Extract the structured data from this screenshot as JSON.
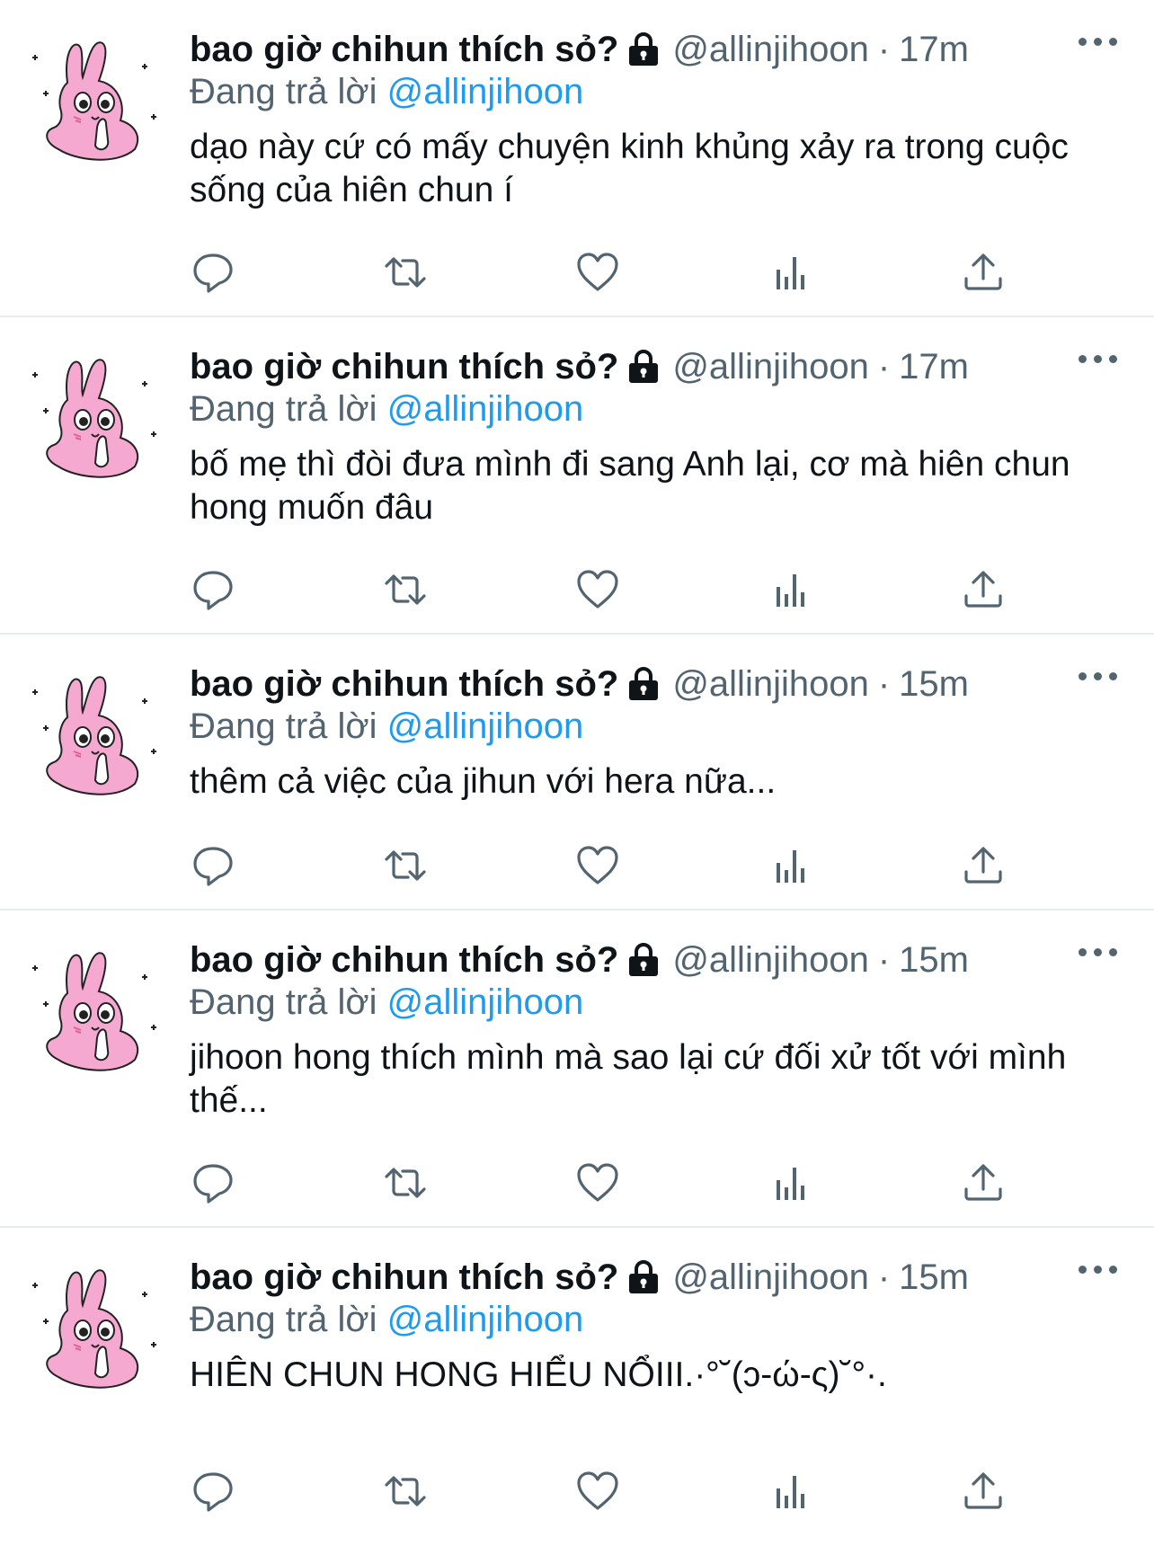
{
  "tweets": [
    {
      "display_name": "bao giờ chihun thích sỏ?",
      "handle": "@allinjihoon",
      "separator": "·",
      "time": "17m",
      "reply_prefix": "Đang trả lời",
      "reply_to": "@allinjihoon",
      "text": "dạo này cứ có mấy chuyện kinh khủng xảy ra trong cuộc sống của hiên chun í"
    },
    {
      "display_name": "bao giờ chihun thích sỏ?",
      "handle": "@allinjihoon",
      "separator": "·",
      "time": "17m",
      "reply_prefix": "Đang trả lời",
      "reply_to": "@allinjihoon",
      "text": "bố mẹ thì đòi đưa mình đi sang Anh lại, cơ mà hiên chun hong muốn đâu"
    },
    {
      "display_name": "bao giờ chihun thích sỏ?",
      "handle": "@allinjihoon",
      "separator": "·",
      "time": "15m",
      "reply_prefix": "Đang trả lời",
      "reply_to": "@allinjihoon",
      "text": "thêm cả việc của jihun với hera nữa..."
    },
    {
      "display_name": "bao giờ chihun thích sỏ?",
      "handle": "@allinjihoon",
      "separator": "·",
      "time": "15m",
      "reply_prefix": "Đang trả lời",
      "reply_to": "@allinjihoon",
      "text": "jihoon hong thích mình mà sao lại cứ đối xử tốt với mình thế..."
    },
    {
      "display_name": "bao giờ chihun thích sỏ?",
      "handle": "@allinjihoon",
      "separator": "·",
      "time": "15m",
      "reply_prefix": "Đang trả lời",
      "reply_to": "@allinjihoon",
      "text": "HIÊN CHUN HONG HIỂU NỔIII.·°˘(ↄ-ώ-ς)˘°·."
    }
  ],
  "icons": {
    "avatar": "pink-bunny-avatar",
    "lock": "lock-icon",
    "more": "more-options-icon",
    "reply": "reply-icon",
    "retweet": "retweet-icon",
    "like": "heart-icon",
    "views": "views-chart-icon",
    "share": "share-icon"
  },
  "colors": {
    "text": "#0f1419",
    "secondary": "#536471",
    "link": "#1d9bf0",
    "divider": "#e6ecf0",
    "avatar_pink": "#f5a8d0"
  }
}
